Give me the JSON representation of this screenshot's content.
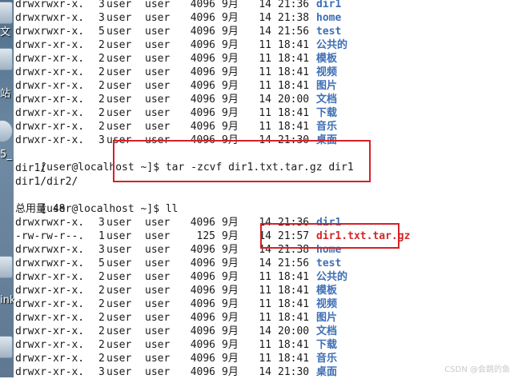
{
  "desktop": {
    "labels": [
      "文",
      "站",
      "5_",
      "ink"
    ],
    "icons": [
      "folder-icon",
      "dvd-icon",
      "link-icon",
      "file-icon"
    ]
  },
  "terminal": {
    "listing1": [
      {
        "perm": "drwxrwxr-x.",
        "links": "3",
        "user": "user",
        "group": "user",
        "size": "4096",
        "month": "9月",
        "day": "14",
        "time": "21:36",
        "name": "dir1",
        "type": "dir"
      },
      {
        "perm": "drwxrwxr-x.",
        "links": "3",
        "user": "user",
        "group": "user",
        "size": "4096",
        "month": "9月",
        "day": "14",
        "time": "21:38",
        "name": "home",
        "type": "dir"
      },
      {
        "perm": "drwxrwxr-x.",
        "links": "5",
        "user": "user",
        "group": "user",
        "size": "4096",
        "month": "9月",
        "day": "14",
        "time": "21:56",
        "name": "test",
        "type": "dir"
      },
      {
        "perm": "drwxr-xr-x.",
        "links": "2",
        "user": "user",
        "group": "user",
        "size": "4096",
        "month": "9月",
        "day": "11",
        "time": "18:41",
        "name": "公共的",
        "type": "dir"
      },
      {
        "perm": "drwxr-xr-x.",
        "links": "2",
        "user": "user",
        "group": "user",
        "size": "4096",
        "month": "9月",
        "day": "11",
        "time": "18:41",
        "name": "模板",
        "type": "dir"
      },
      {
        "perm": "drwxr-xr-x.",
        "links": "2",
        "user": "user",
        "group": "user",
        "size": "4096",
        "month": "9月",
        "day": "11",
        "time": "18:41",
        "name": "视频",
        "type": "dir"
      },
      {
        "perm": "drwxr-xr-x.",
        "links": "2",
        "user": "user",
        "group": "user",
        "size": "4096",
        "month": "9月",
        "day": "11",
        "time": "18:41",
        "name": "图片",
        "type": "dir"
      },
      {
        "perm": "drwxr-xr-x.",
        "links": "2",
        "user": "user",
        "group": "user",
        "size": "4096",
        "month": "9月",
        "day": "14",
        "time": "20:00",
        "name": "文档",
        "type": "dir"
      },
      {
        "perm": "drwxr-xr-x.",
        "links": "2",
        "user": "user",
        "group": "user",
        "size": "4096",
        "month": "9月",
        "day": "11",
        "time": "18:41",
        "name": "下载",
        "type": "dir"
      },
      {
        "perm": "drwxr-xr-x.",
        "links": "2",
        "user": "user",
        "group": "user",
        "size": "4096",
        "month": "9月",
        "day": "11",
        "time": "18:41",
        "name": "音乐",
        "type": "dir"
      },
      {
        "perm": "drwxr-xr-x.",
        "links": "3",
        "user": "user",
        "group": "user",
        "size": "4096",
        "month": "9月",
        "day": "14",
        "time": "21:30",
        "name": "桌面",
        "type": "dir"
      }
    ],
    "cmd1_prompt": "[user@localhost ~]$ ",
    "cmd1": "tar -zcvf dir1.txt.tar.gz dir1",
    "out1": "dir1/",
    "out2": "dir1/dir2/",
    "cmd2_prompt": "[user@localhost ~]$ ",
    "cmd2": "ll",
    "total": "总用量 48",
    "listing2": [
      {
        "perm": "drwxrwxr-x.",
        "links": "3",
        "user": "user",
        "group": "user",
        "size": "4096",
        "month": "9月",
        "day": "14",
        "time": "21:36",
        "name": "dir1",
        "type": "dir"
      },
      {
        "perm": "-rw-rw-r--.",
        "links": "1",
        "user": "user",
        "group": "user",
        "size": "125",
        "month": "9月",
        "day": "14",
        "time": "21:57",
        "name": "dir1.txt.tar.gz",
        "type": "arch"
      },
      {
        "perm": "drwxrwxr-x.",
        "links": "3",
        "user": "user",
        "group": "user",
        "size": "4096",
        "month": "9月",
        "day": "14",
        "time": "21:38",
        "name": "home",
        "type": "dir"
      },
      {
        "perm": "drwxrwxr-x.",
        "links": "5",
        "user": "user",
        "group": "user",
        "size": "4096",
        "month": "9月",
        "day": "14",
        "time": "21:56",
        "name": "test",
        "type": "dir"
      },
      {
        "perm": "drwxr-xr-x.",
        "links": "2",
        "user": "user",
        "group": "user",
        "size": "4096",
        "month": "9月",
        "day": "11",
        "time": "18:41",
        "name": "公共的",
        "type": "dir"
      },
      {
        "perm": "drwxr-xr-x.",
        "links": "2",
        "user": "user",
        "group": "user",
        "size": "4096",
        "month": "9月",
        "day": "11",
        "time": "18:41",
        "name": "模板",
        "type": "dir"
      },
      {
        "perm": "drwxr-xr-x.",
        "links": "2",
        "user": "user",
        "group": "user",
        "size": "4096",
        "month": "9月",
        "day": "11",
        "time": "18:41",
        "name": "视频",
        "type": "dir"
      },
      {
        "perm": "drwxr-xr-x.",
        "links": "2",
        "user": "user",
        "group": "user",
        "size": "4096",
        "month": "9月",
        "day": "11",
        "time": "18:41",
        "name": "图片",
        "type": "dir"
      },
      {
        "perm": "drwxr-xr-x.",
        "links": "2",
        "user": "user",
        "group": "user",
        "size": "4096",
        "month": "9月",
        "day": "14",
        "time": "20:00",
        "name": "文档",
        "type": "dir"
      },
      {
        "perm": "drwxr-xr-x.",
        "links": "2",
        "user": "user",
        "group": "user",
        "size": "4096",
        "month": "9月",
        "day": "11",
        "time": "18:41",
        "name": "下载",
        "type": "dir"
      },
      {
        "perm": "drwxr-xr-x.",
        "links": "2",
        "user": "user",
        "group": "user",
        "size": "4096",
        "month": "9月",
        "day": "11",
        "time": "18:41",
        "name": "音乐",
        "type": "dir"
      },
      {
        "perm": "drwxr-xr-x.",
        "links": "3",
        "user": "user",
        "group": "user",
        "size": "4096",
        "month": "9月",
        "day": "14",
        "time": "21:30",
        "name": "桌面",
        "type": "dir"
      }
    ]
  },
  "watermark": "CSDN @会跳的鱼",
  "colors": {
    "dir": "#3d6fb5",
    "archive": "#d12828",
    "highlight": "#d62027"
  }
}
